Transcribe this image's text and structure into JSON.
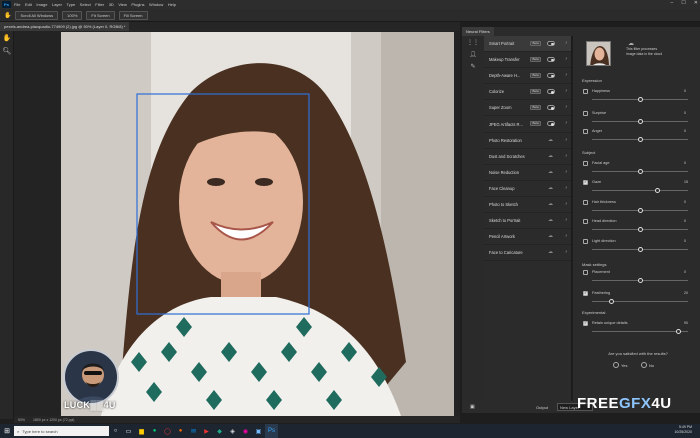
{
  "menubar": {
    "app_icon": "Ps",
    "items": [
      "File",
      "Edit",
      "Image",
      "Layer",
      "Type",
      "Select",
      "Filter",
      "3D",
      "View",
      "Plugins",
      "Window",
      "Help"
    ]
  },
  "options_bar": {
    "buttons": [
      "Scroll All Windows",
      "100%",
      "Fit Screen",
      "Fill Screen"
    ]
  },
  "document_tab": "pexels-andrea-piacquadio-774909 (2).jpg @ 50% (Layer 0, RGB/8) *",
  "status_bar": {
    "zoom": "50%",
    "doc_info": "1800 px x 1200 px (72 ppi)"
  },
  "neural_filters": {
    "panel_title": "Neural Filters",
    "filters": [
      {
        "label": "Smart Portrait",
        "badge": "Beta",
        "control": "toggle",
        "selected": true
      },
      {
        "label": "Makeup Transfer",
        "badge": "Beta",
        "control": "toggle"
      },
      {
        "label": "Depth-Aware H...",
        "badge": "Beta",
        "control": "toggle"
      },
      {
        "label": "Colorize",
        "badge": "Beta",
        "control": "toggle"
      },
      {
        "label": "Super Zoom",
        "badge": "Beta",
        "control": "toggle"
      },
      {
        "label": "JPEG Artifacts R...",
        "badge": "Beta",
        "control": "toggle"
      },
      {
        "label": "Photo Restoration",
        "badge": "",
        "control": "cloud"
      },
      {
        "label": "Dust and Scratches",
        "badge": "",
        "control": "cloud"
      },
      {
        "label": "Noise Reduction",
        "badge": "",
        "control": "cloud"
      },
      {
        "label": "Face Cleanup",
        "badge": "",
        "control": "cloud"
      },
      {
        "label": "Photo to Sketch",
        "badge": "",
        "control": "cloud"
      },
      {
        "label": "Sketch to Portrait",
        "badge": "",
        "control": "cloud"
      },
      {
        "label": "Pencil Artwork",
        "badge": "",
        "control": "cloud"
      },
      {
        "label": "Face to Caricature",
        "badge": "",
        "control": "cloud"
      }
    ],
    "thumb_note": "This filter processes image data in the cloud",
    "sections": {
      "expression": "Expression",
      "subject": "Subject",
      "mask_settings": "Mask settings",
      "experimental": "Experimental"
    },
    "sliders": [
      {
        "label": "Happiness",
        "checked": false,
        "value": "0",
        "position": 0.5
      },
      {
        "label": "Surprise",
        "checked": false,
        "value": "0",
        "position": 0.5
      },
      {
        "label": "Anger",
        "checked": false,
        "value": "0",
        "position": 0.5
      },
      {
        "label": "Facial age",
        "checked": false,
        "value": "0",
        "position": 0.5
      },
      {
        "label": "Gaze",
        "checked": true,
        "value": "15",
        "position": 0.68
      },
      {
        "label": "Hair thickness",
        "checked": false,
        "value": "0",
        "position": 0.5
      },
      {
        "label": "Head direction",
        "checked": false,
        "value": "0",
        "position": 0.5
      },
      {
        "label": "Light direction",
        "checked": false,
        "value": "0",
        "position": 0.5
      },
      {
        "label": "Placement",
        "checked": false,
        "value": "0",
        "position": 0.5
      },
      {
        "label": "Feathering",
        "checked": true,
        "value": "20",
        "position": 0.2
      },
      {
        "label": "Retain unique details",
        "checked": true,
        "value": "90",
        "position": 0.9
      }
    ],
    "question": "Are you satisfied with the results?",
    "answers": [
      "Yes",
      "No"
    ],
    "output_label": "Output",
    "output_value": "New Layer"
  },
  "watermark": {
    "part1": "FREE",
    "part2": "GFX",
    "part3": "4U"
  },
  "badge_text": {
    "left": "LUCK",
    "right": "4U"
  },
  "taskbar": {
    "search_placeholder": "Type here to search",
    "time": "5:49 PM",
    "date": "10/25/2020"
  }
}
